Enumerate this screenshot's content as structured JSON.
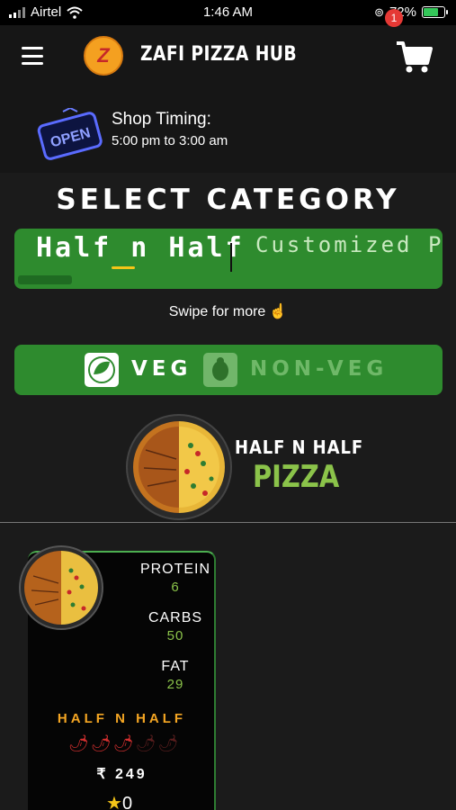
{
  "status_bar": {
    "carrier": "Airtel",
    "time": "1:46 AM",
    "battery": "72%"
  },
  "header": {
    "brand": "ZAFI PIZZA HUB",
    "logo_text": "Z",
    "cart_count": "1",
    "menu_icon": "hamburger-icon",
    "cart_icon": "cart-icon"
  },
  "shop_timing": {
    "title": "Shop Timing:",
    "hours": "5:00 pm to 3:00 am",
    "sign_text": "OPEN"
  },
  "category": {
    "title": "SELECT CATEGORY",
    "items": [
      "Half n Half",
      "Customized P"
    ],
    "swipe_hint": "Swipe for more"
  },
  "diet_toggle": {
    "veg_label": "VEG",
    "nonveg_label": "NON-VEG"
  },
  "hero": {
    "line1": "HALF N HALF",
    "line2": "PIZZA"
  },
  "product": {
    "name": "HALF N HALF",
    "nutrition": [
      {
        "label": "PROTEIN",
        "value": "6"
      },
      {
        "label": "CARBS",
        "value": "50"
      },
      {
        "label": "FAT",
        "value": "29"
      }
    ],
    "spice_level": 3,
    "spice_max": 5,
    "price": "₹ 249",
    "rating": "0"
  },
  "colors": {
    "accent_green": "#2e8b2e",
    "highlight_yellow": "#f5c518",
    "name_orange": "#f5a623",
    "value_green": "#8bc34a"
  }
}
